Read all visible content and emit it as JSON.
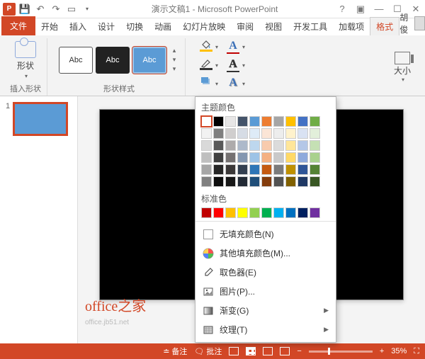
{
  "titlebar": {
    "title": "演示文稿1 - Microsoft PowerPoint"
  },
  "tabs": {
    "file": "文件",
    "home": "开始",
    "insert": "插入",
    "design": "设计",
    "transitions": "切换",
    "animations": "动画",
    "slideshow": "幻灯片放映",
    "review": "审阅",
    "view": "视图",
    "developer": "开发工具",
    "addins": "加载项",
    "format": "格式",
    "username": "胡俊"
  },
  "ribbon": {
    "group_insert_shapes": "插入形状",
    "shape_label": "形状",
    "group_shape_styles": "形状样式",
    "style_text": "Abc",
    "group_size": "大小"
  },
  "popup": {
    "theme_colors": "主题颜色",
    "standard_colors": "标准色",
    "no_fill": "无填充颜色(N)",
    "more_colors": "其他填充颜色(M)...",
    "eyedropper": "取色器(E)",
    "picture": "图片(P)...",
    "gradient": "渐变(G)",
    "texture": "纹理(T)",
    "theme_row1": [
      "#ffffff",
      "#000000",
      "#e7e6e6",
      "#44546a",
      "#5b9bd5",
      "#ed7d31",
      "#a5a5a5",
      "#ffc000",
      "#4472c4",
      "#70ad47"
    ],
    "theme_shades": [
      [
        "#f2f2f2",
        "#7f7f7f",
        "#d0cece",
        "#d6dce5",
        "#deebf7",
        "#fbe5d6",
        "#ededed",
        "#fff2cc",
        "#d9e2f3",
        "#e2efda"
      ],
      [
        "#d9d9d9",
        "#595959",
        "#aeabab",
        "#adb9ca",
        "#bdd7ee",
        "#f8cbad",
        "#dbdbdb",
        "#ffe699",
        "#b4c7e7",
        "#c5e0b4"
      ],
      [
        "#bfbfbf",
        "#404040",
        "#757171",
        "#8497b0",
        "#9dc3e6",
        "#f4b183",
        "#c9c9c9",
        "#ffd966",
        "#8faadc",
        "#a9d18e"
      ],
      [
        "#a6a6a6",
        "#262626",
        "#3b3838",
        "#333f50",
        "#2e75b6",
        "#c55a11",
        "#7b7b7b",
        "#bf9000",
        "#2f5597",
        "#548235"
      ],
      [
        "#808080",
        "#0d0d0d",
        "#171717",
        "#222a35",
        "#1f4e79",
        "#843c0c",
        "#525252",
        "#806000",
        "#1f3864",
        "#385724"
      ]
    ],
    "standard_row": [
      "#c00000",
      "#ff0000",
      "#ffc000",
      "#ffff00",
      "#92d050",
      "#00b050",
      "#00b0f0",
      "#0070c0",
      "#002060",
      "#7030a0"
    ]
  },
  "thumbnails": {
    "n1": "1"
  },
  "watermark": {
    "main": "office之家",
    "sub": "office.jb51.net"
  },
  "statusbar": {
    "notes": "备注",
    "comments": "批注",
    "zoom": "35%"
  }
}
